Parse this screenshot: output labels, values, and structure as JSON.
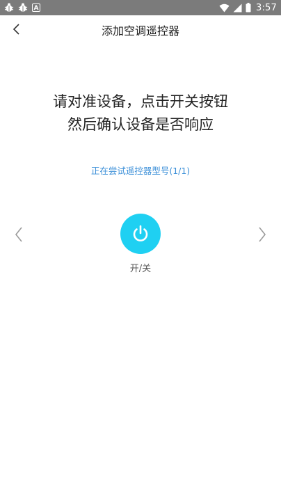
{
  "status_bar": {
    "time": "3:57",
    "icons": [
      "bug-icon",
      "bug-icon",
      "a-notification-icon",
      "wifi-icon",
      "signal-icon",
      "battery-icon"
    ]
  },
  "header": {
    "title": "添加空调遥控器",
    "back_icon": "chevron-left-icon"
  },
  "instruction": {
    "line1": "请对准设备，点击开关按钮",
    "line2": "然后确认设备是否响应"
  },
  "status_text": "正在尝试遥控器型号(1/1)",
  "power": {
    "label": "开/关",
    "icon": "power-icon",
    "color": "#1fd0f2"
  },
  "nav": {
    "prev_icon": "chevron-left-icon",
    "next_icon": "chevron-right-icon"
  },
  "colors": {
    "accent_blue_text": "#3b8fd8",
    "status_bar_bg": "#7b7b7b"
  }
}
